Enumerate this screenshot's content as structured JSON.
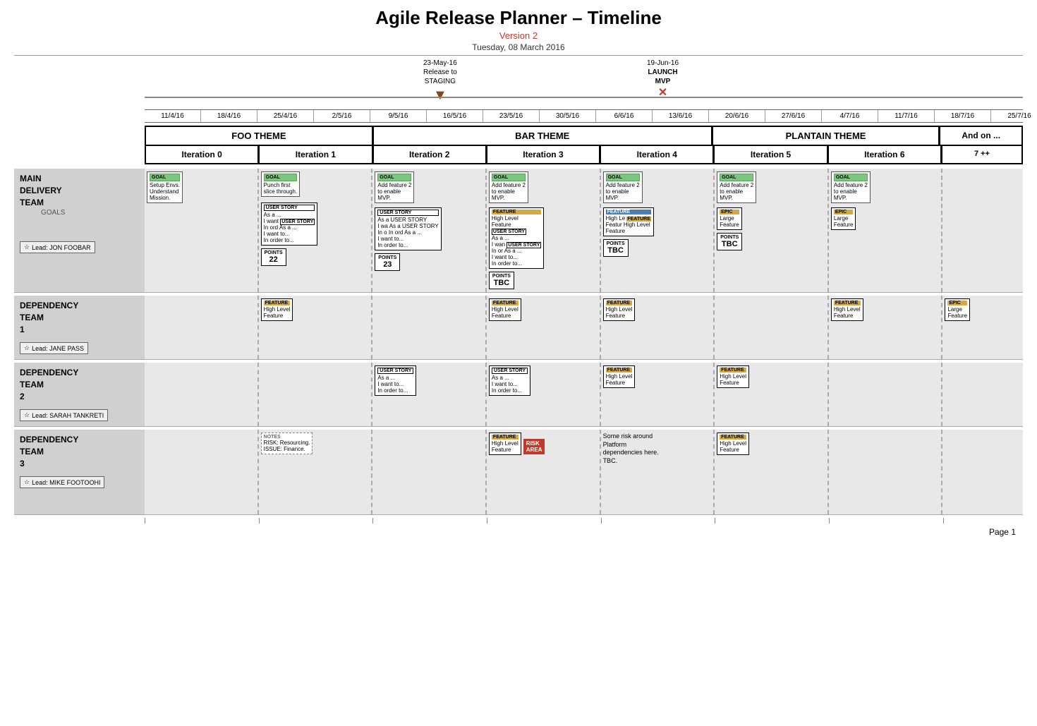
{
  "header": {
    "title": "Agile Release Planner – Timeline",
    "version": "Version 2",
    "date": "Tuesday, 08 March 2016"
  },
  "milestones": [
    {
      "id": "staging",
      "date": "23-May-16",
      "label": "Release to\nSTAGING",
      "arrow": "▼",
      "color": "#8B4513"
    },
    {
      "id": "launch",
      "date": "19-Jun-16",
      "label": "LAUNCH\nMVP",
      "arrow": "✕",
      "color": "#c0392b"
    }
  ],
  "dates": [
    "11/4/16",
    "18/4/16",
    "25/4/16",
    "2/5/16",
    "9/5/16",
    "16/5/16",
    "23/5/16",
    "30/5/16",
    "6/6/16",
    "13/6/16",
    "20/6/16",
    "27/6/16",
    "4/7/16",
    "11/7/16",
    "18/7/16",
    "25/7/16"
  ],
  "themes": [
    {
      "label": "FOO THEME",
      "span": 2
    },
    {
      "label": "BAR THEME",
      "span": 3
    },
    {
      "label": "PLANTAIN THEME",
      "span": 2
    },
    {
      "label": "And on ...",
      "span": 0.7
    }
  ],
  "iterations": [
    {
      "label": "Iteration 0"
    },
    {
      "label": "Iteration 1"
    },
    {
      "label": "Iteration 2"
    },
    {
      "label": "Iteration 3"
    },
    {
      "label": "Iteration 4"
    },
    {
      "label": "Iteration 5"
    },
    {
      "label": "Iteration 6"
    },
    {
      "label": "7 ++"
    }
  ],
  "teams": [
    {
      "id": "main",
      "title": "MAIN\nDELIVERY\nTEAM",
      "goals_label": "GOALS",
      "lead": "Lead: JON FOOBAR",
      "cols": [
        {
          "iter": 0,
          "items": [
            {
              "type": "goal",
              "text": "Setup Envs.\nUnderstand\nMission."
            }
          ]
        },
        {
          "iter": 1,
          "items": [
            {
              "type": "goal",
              "text": "Punch first\nslice through."
            },
            {
              "type": "userstory",
              "text": "As a ...\nI want USER STORY\nIn ord As a ...\nI want to...\nIn order to..."
            },
            {
              "type": "points",
              "label": "POINTS",
              "value": "22"
            }
          ]
        },
        {
          "iter": 2,
          "items": [
            {
              "type": "goal",
              "text": "Add feature 2\nto enable\nMVP."
            },
            {
              "type": "userstory",
              "text": "As a USER STORY\nI wa As a USER STORY\nIn o In ord As a ...\nI want to...\nIn order to..."
            },
            {
              "type": "points",
              "label": "POINTS",
              "value": "23"
            }
          ]
        },
        {
          "iter": 3,
          "items": [
            {
              "type": "goal",
              "text": "Add feature 2\nto enable\nMVP."
            },
            {
              "type": "feature",
              "text": "High Level\nFeature USER STORY\nAs a ...\nI wan USER STORY\nIn or As a ...\nI want to...\nIn order to..."
            },
            {
              "type": "points",
              "label": "POINTS",
              "value": "TBC"
            }
          ]
        },
        {
          "iter": 4,
          "items": [
            {
              "type": "goal",
              "text": "Add feature 2\nto enable\nMVP."
            },
            {
              "type": "feature-blue",
              "text": "High Le FEATURE\nFeatur High Level\nFeature"
            },
            {
              "type": "points",
              "label": "POINTS",
              "value": "TBC"
            }
          ]
        },
        {
          "iter": 5,
          "items": [
            {
              "type": "goal",
              "text": "Add feature 2\nto enable\nMVP."
            },
            {
              "type": "epic",
              "text": "Large\nFeature"
            },
            {
              "type": "points",
              "label": "POINTS",
              "value": "TBC"
            }
          ]
        },
        {
          "iter": 6,
          "items": [
            {
              "type": "goal",
              "text": "Add feature 2\nto enable\nMVP."
            },
            {
              "type": "epic",
              "text": "Large\nFeature"
            }
          ]
        },
        {
          "iter": 7,
          "items": []
        }
      ]
    },
    {
      "id": "dep1",
      "title": "DEPENDENCY\nTEAM\n1",
      "lead": "Lead: JANE PASS",
      "cols": [
        {
          "iter": 0,
          "items": []
        },
        {
          "iter": 1,
          "items": [
            {
              "type": "feature",
              "text": "High Level\nFeature"
            }
          ]
        },
        {
          "iter": 2,
          "items": []
        },
        {
          "iter": 3,
          "items": [
            {
              "type": "feature",
              "text": "High Level\nFeature"
            }
          ]
        },
        {
          "iter": 4,
          "items": [
            {
              "type": "feature",
              "text": "High Level\nFeature"
            }
          ]
        },
        {
          "iter": 5,
          "items": []
        },
        {
          "iter": 6,
          "items": [
            {
              "type": "feature",
              "text": "High Level\nFeature"
            }
          ]
        },
        {
          "iter": 7,
          "items": [
            {
              "type": "epic",
              "text": "Large\nFeature"
            }
          ]
        }
      ]
    },
    {
      "id": "dep2",
      "title": "DEPENDENCY\nTEAM\n2",
      "lead": "Lead: SARAH TANKRETI",
      "cols": [
        {
          "iter": 0,
          "items": []
        },
        {
          "iter": 1,
          "items": []
        },
        {
          "iter": 2,
          "items": [
            {
              "type": "userstory",
              "text": "As a ...\nI want to...\nIn order to..."
            }
          ]
        },
        {
          "iter": 3,
          "items": [
            {
              "type": "userstory",
              "text": "As a ...\nI want to...\nIn order to..."
            }
          ]
        },
        {
          "iter": 4,
          "items": [
            {
              "type": "feature",
              "text": "High Level\nFeature"
            }
          ]
        },
        {
          "iter": 5,
          "items": [
            {
              "type": "feature",
              "text": "High Level\nFeature"
            }
          ]
        },
        {
          "iter": 6,
          "items": []
        },
        {
          "iter": 7,
          "items": []
        }
      ]
    },
    {
      "id": "dep3",
      "title": "DEPENDENCY\nTEAM\n3",
      "lead": "Lead: MIKE FOOTOOHI",
      "cols": [
        {
          "iter": 0,
          "items": []
        },
        {
          "iter": 1,
          "items": [
            {
              "type": "notes",
              "text": "RISK: Resourcing.\nISSUE: Finance."
            }
          ]
        },
        {
          "iter": 2,
          "items": []
        },
        {
          "iter": 3,
          "items": [
            {
              "type": "feature",
              "text": "High Level\nFeature"
            },
            {
              "type": "risk",
              "text": "RISK\nAREA"
            }
          ]
        },
        {
          "iter": 4,
          "items": [
            {
              "type": "text",
              "text": "Some risk around\nPlatform\ndependencies here.\nTBC."
            }
          ]
        },
        {
          "iter": 5,
          "items": [
            {
              "type": "feature",
              "text": "High Level\nFeature"
            }
          ]
        },
        {
          "iter": 6,
          "items": []
        },
        {
          "iter": 7,
          "items": []
        }
      ]
    }
  ],
  "page_number": "Page 1"
}
